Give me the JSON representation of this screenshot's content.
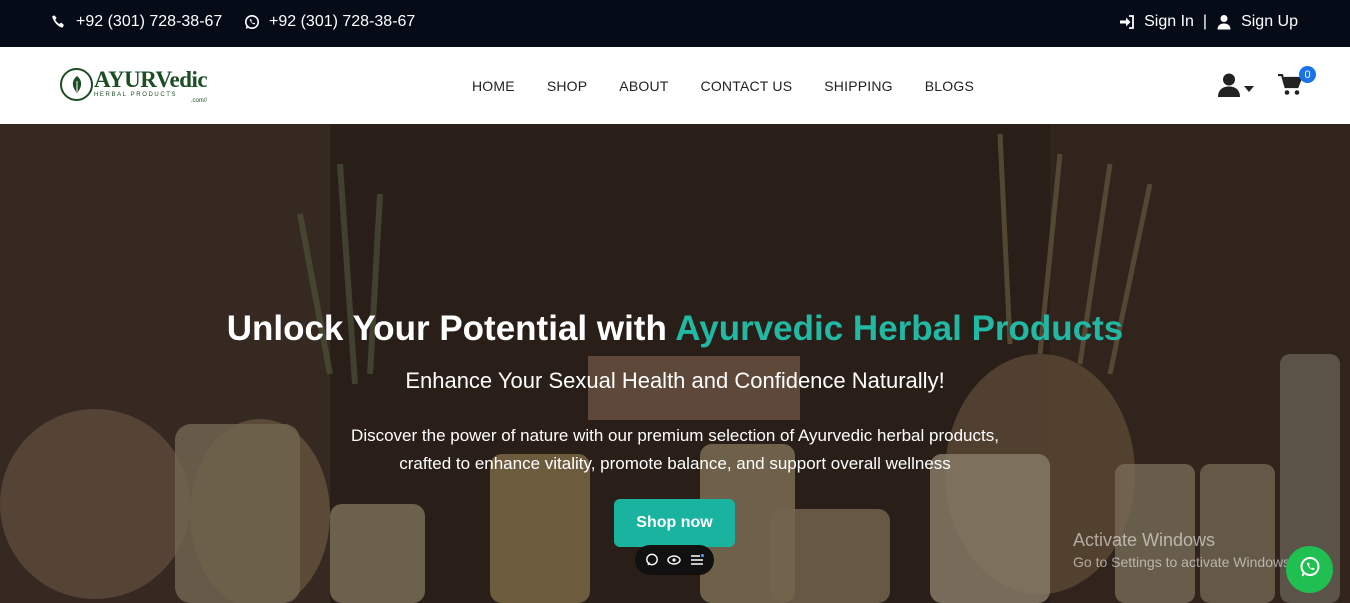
{
  "topbar": {
    "phone": "+92 (301) 728-38-67",
    "whatsapp": "+92 (301) 728-38-67",
    "sign_in": "Sign In",
    "divider": "|",
    "sign_up": "Sign Up"
  },
  "logo": {
    "brand": "AYURVedic",
    "tagline": "HERBAL PRODUCTS",
    "domain": ".com//"
  },
  "menu": [
    {
      "label": "HOME"
    },
    {
      "label": "SHOP"
    },
    {
      "label": "ABOUT"
    },
    {
      "label": "CONTACT US"
    },
    {
      "label": "SHIPPING"
    },
    {
      "label": "BLOGS"
    }
  ],
  "cart": {
    "count": "0"
  },
  "hero": {
    "title_main": "Unlock Your Potential with ",
    "title_highlight": "Ayurvedic Herbal Products",
    "subtitle": "Enhance Your Sexual Health and Confidence Naturally!",
    "description": "Discover the power of nature with our premium selection of Ayurvedic herbal products, crafted to enhance vitality, promote balance, and support overall wellness",
    "cta": "Shop now"
  },
  "watermark": {
    "line1": "Activate Windows",
    "line2": "Go to Settings to activate Windows."
  },
  "colors": {
    "topbar_bg": "#050b17",
    "accent": "#19b3a0",
    "logo_green": "#1d4d24",
    "badge": "#1a73e8",
    "whatsapp": "#1fbf51"
  },
  "icons": [
    "phone-icon",
    "whatsapp-icon",
    "sign-in-icon",
    "user-icon",
    "account-icon",
    "caret-down-icon",
    "cart-icon",
    "chat-icon",
    "eye-icon",
    "list-icon"
  ]
}
